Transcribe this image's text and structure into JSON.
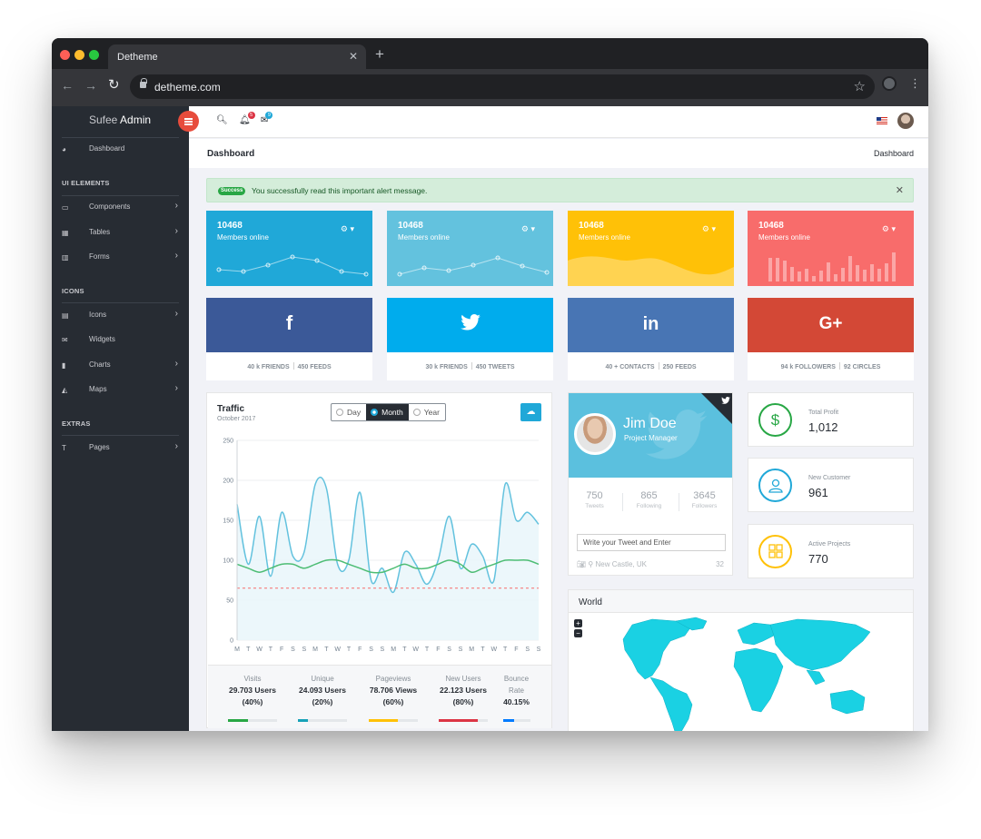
{
  "browser": {
    "tab_title": "Detheme",
    "url": "detheme.com",
    "colors": {
      "close": "#ff5f57",
      "minimize": "#febc2e",
      "maximize": "#28c840"
    }
  },
  "sidebar": {
    "logo_light": "Sufee ",
    "logo_bold": "Admin",
    "dashboard_label": "Dashboard",
    "sections": [
      {
        "title": "UI ELEMENTS",
        "items": [
          {
            "label": "Components",
            "icon": "laptop-icon"
          },
          {
            "label": "Tables",
            "icon": "table-icon"
          },
          {
            "label": "Forms",
            "icon": "grid-icon"
          }
        ]
      },
      {
        "title": "ICONS",
        "items": [
          {
            "label": "Icons",
            "icon": "list-icon"
          },
          {
            "label": "Widgets",
            "icon": "envelope-icon"
          },
          {
            "label": "Charts",
            "icon": "bar-chart-icon"
          },
          {
            "label": "Maps",
            "icon": "area-chart-icon"
          }
        ]
      },
      {
        "title": "EXTRAS",
        "items": [
          {
            "label": "Pages",
            "icon": "text-icon"
          }
        ]
      }
    ]
  },
  "header": {
    "notification_count": "5",
    "message_count": "9"
  },
  "breadcrumb": {
    "page_title": "Dashboard",
    "crumb": "Dashboard"
  },
  "alert": {
    "badge": "Success",
    "message": "You successfully read this important alert message."
  },
  "stat_cards": [
    {
      "value": "10468",
      "label": "Members online",
      "color": "#20a8d8",
      "chart": "line"
    },
    {
      "value": "10468",
      "label": "Members online",
      "color": "#63c2de",
      "chart": "line"
    },
    {
      "value": "10468",
      "label": "Members online",
      "color": "#ffc107",
      "chart": "area"
    },
    {
      "value": "10468",
      "label": "Members online",
      "color": "#f86c6b",
      "chart": "bar"
    }
  ],
  "social_cards": [
    {
      "network": "facebook",
      "glyph": "f",
      "color": "#3b5998",
      "stat1": "40 k FRIENDS",
      "stat2": "450 FEEDS"
    },
    {
      "network": "twitter",
      "glyph": "🐦",
      "color": "#00aced",
      "stat1": "30 k FRIENDS",
      "stat2": "450 TWEETS"
    },
    {
      "network": "linkedin",
      "glyph": "in",
      "color": "#4875b4",
      "stat1": "40 + CONTACTS",
      "stat2": "250 FEEDS"
    },
    {
      "network": "google-plus",
      "glyph": "G+",
      "color": "#d34836",
      "stat1": "94 k FOLLOWERS",
      "stat2": "92 CIRCLES"
    }
  ],
  "traffic": {
    "title": "Traffic",
    "subtitle": "October 2017",
    "range_options": [
      "Day",
      "Month",
      "Year"
    ],
    "selected_range": "Month",
    "stats": [
      {
        "label": "Visits",
        "value": "29.703 Users",
        "percent": "(40%)",
        "color": "#28a745",
        "fill": 0.4
      },
      {
        "label": "Unique",
        "value": "24.093 Users",
        "percent": "(20%)",
        "color": "#17a2b8",
        "fill": 0.2
      },
      {
        "label": "Pageviews",
        "value": "78.706 Views",
        "percent": "(60%)",
        "color": "#ffc107",
        "fill": 0.6
      },
      {
        "label": "New Users",
        "value": "22.123 Users",
        "percent": "(80%)",
        "color": "#dc3545",
        "fill": 0.8
      },
      {
        "label": "Bounce Rate",
        "value": "40.15%",
        "percent": "",
        "color": "#007bff",
        "fill": 0.4015
      }
    ]
  },
  "chart_data": {
    "type": "line",
    "ylim": [
      0,
      250
    ],
    "yticks": [
      0,
      50,
      100,
      150,
      200,
      250
    ],
    "x": [
      "M",
      "T",
      "W",
      "T",
      "F",
      "S",
      "S",
      "M",
      "T",
      "W",
      "T",
      "F",
      "S",
      "S",
      "M",
      "T",
      "W",
      "T",
      "F",
      "S",
      "S",
      "M",
      "T",
      "W",
      "T",
      "F",
      "S",
      "S"
    ],
    "series": [
      {
        "values": [
          170,
          95,
          155,
          80,
          160,
          105,
          110,
          195,
          190,
          95,
          100,
          185,
          75,
          90,
          60,
          110,
          95,
          70,
          100,
          155,
          90,
          120,
          105,
          75,
          195,
          150,
          160,
          145
        ],
        "color": "#63c2de",
        "fill": "#eaf6fb"
      },
      {
        "values": [
          95,
          90,
          85,
          90,
          95,
          95,
          90,
          95,
          100,
          100,
          95,
          90,
          85,
          85,
          90,
          95,
          90,
          90,
          95,
          100,
          95,
          85,
          90,
          95,
          100,
          100,
          100,
          95
        ],
        "color": "#4dbd74",
        "fill": "none"
      },
      {
        "values": [
          65,
          65,
          65,
          65,
          65,
          65,
          65,
          65,
          65,
          65,
          65,
          65,
          65,
          65,
          65,
          65,
          65,
          65,
          65,
          65,
          65,
          65,
          65,
          65,
          65,
          65,
          65,
          65
        ],
        "color": "#f86c6b",
        "fill": "none",
        "dashed": true
      }
    ]
  },
  "profile": {
    "name": "Jim Doe",
    "role": "Project Manager",
    "stats": [
      {
        "num": "750",
        "label": "Tweets"
      },
      {
        "num": "865",
        "label": "Following"
      },
      {
        "num": "3645",
        "label": "Followers"
      }
    ],
    "tweet_placeholder": "Write your Tweet and Enter",
    "location": "New Castle, UK",
    "char_count": "32"
  },
  "metrics": [
    {
      "label": "Total Profit",
      "value": "1,012",
      "icon": "dollar-icon",
      "color": "#28a745"
    },
    {
      "label": "New Customer",
      "value": "961",
      "icon": "user-icon",
      "color": "#20a8d8"
    },
    {
      "label": "Active Projects",
      "value": "770",
      "icon": "grid-icon",
      "color": "#ffc107"
    }
  ],
  "world": {
    "title": "World",
    "map_color": "#1ad1e3"
  }
}
